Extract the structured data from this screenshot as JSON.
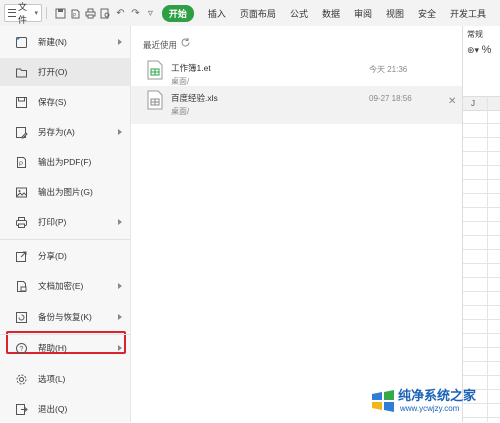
{
  "toolbar": {
    "file_label": "文件",
    "tabs": [
      "开始",
      "插入",
      "页面布局",
      "公式",
      "数据",
      "审阅",
      "视图",
      "安全",
      "开发工具"
    ],
    "active_tab_color": "#2ea043"
  },
  "sheet": {
    "number_format": "常规",
    "percent_symbol": "%",
    "column_header": "J"
  },
  "menu": {
    "items": [
      {
        "label": "新建(N)",
        "icon": "new-doc-icon",
        "has_submenu": true
      },
      {
        "label": "打开(O)",
        "icon": "folder-icon",
        "has_submenu": false
      },
      {
        "label": "保存(S)",
        "icon": "save-icon",
        "has_submenu": false
      },
      {
        "label": "另存为(A)",
        "icon": "save-as-icon",
        "has_submenu": true
      },
      {
        "label": "输出为PDF(F)",
        "icon": "pdf-icon",
        "has_submenu": false
      },
      {
        "label": "输出为图片(G)",
        "icon": "image-icon",
        "has_submenu": false
      },
      {
        "label": "打印(P)",
        "icon": "print-icon",
        "has_submenu": true
      },
      {
        "label": "分享(D)",
        "icon": "share-icon",
        "has_submenu": false
      },
      {
        "label": "文档加密(E)",
        "icon": "encrypt-icon",
        "has_submenu": true
      },
      {
        "label": "备份与恢复(K)",
        "icon": "backup-icon",
        "has_submenu": true
      },
      {
        "label": "帮助(H)",
        "icon": "help-icon",
        "has_submenu": true
      },
      {
        "label": "选项(L)",
        "icon": "gear-icon",
        "has_submenu": false
      },
      {
        "label": "退出(Q)",
        "icon": "exit-icon",
        "has_submenu": false
      }
    ],
    "highlight_color": "#d9232d"
  },
  "recent": {
    "title": "最近使用",
    "files": [
      {
        "name": "工作簿1.et",
        "path": "桌面/",
        "time": "今天 21:36",
        "icon": "spreadsheet-file-icon"
      },
      {
        "name": "百度经验.xls",
        "path": "桌面/",
        "time": "09-27 18:56",
        "icon": "xls-file-icon"
      }
    ]
  },
  "watermark": {
    "title": "纯净系统之家",
    "url": "www.ycwjzy.com"
  }
}
